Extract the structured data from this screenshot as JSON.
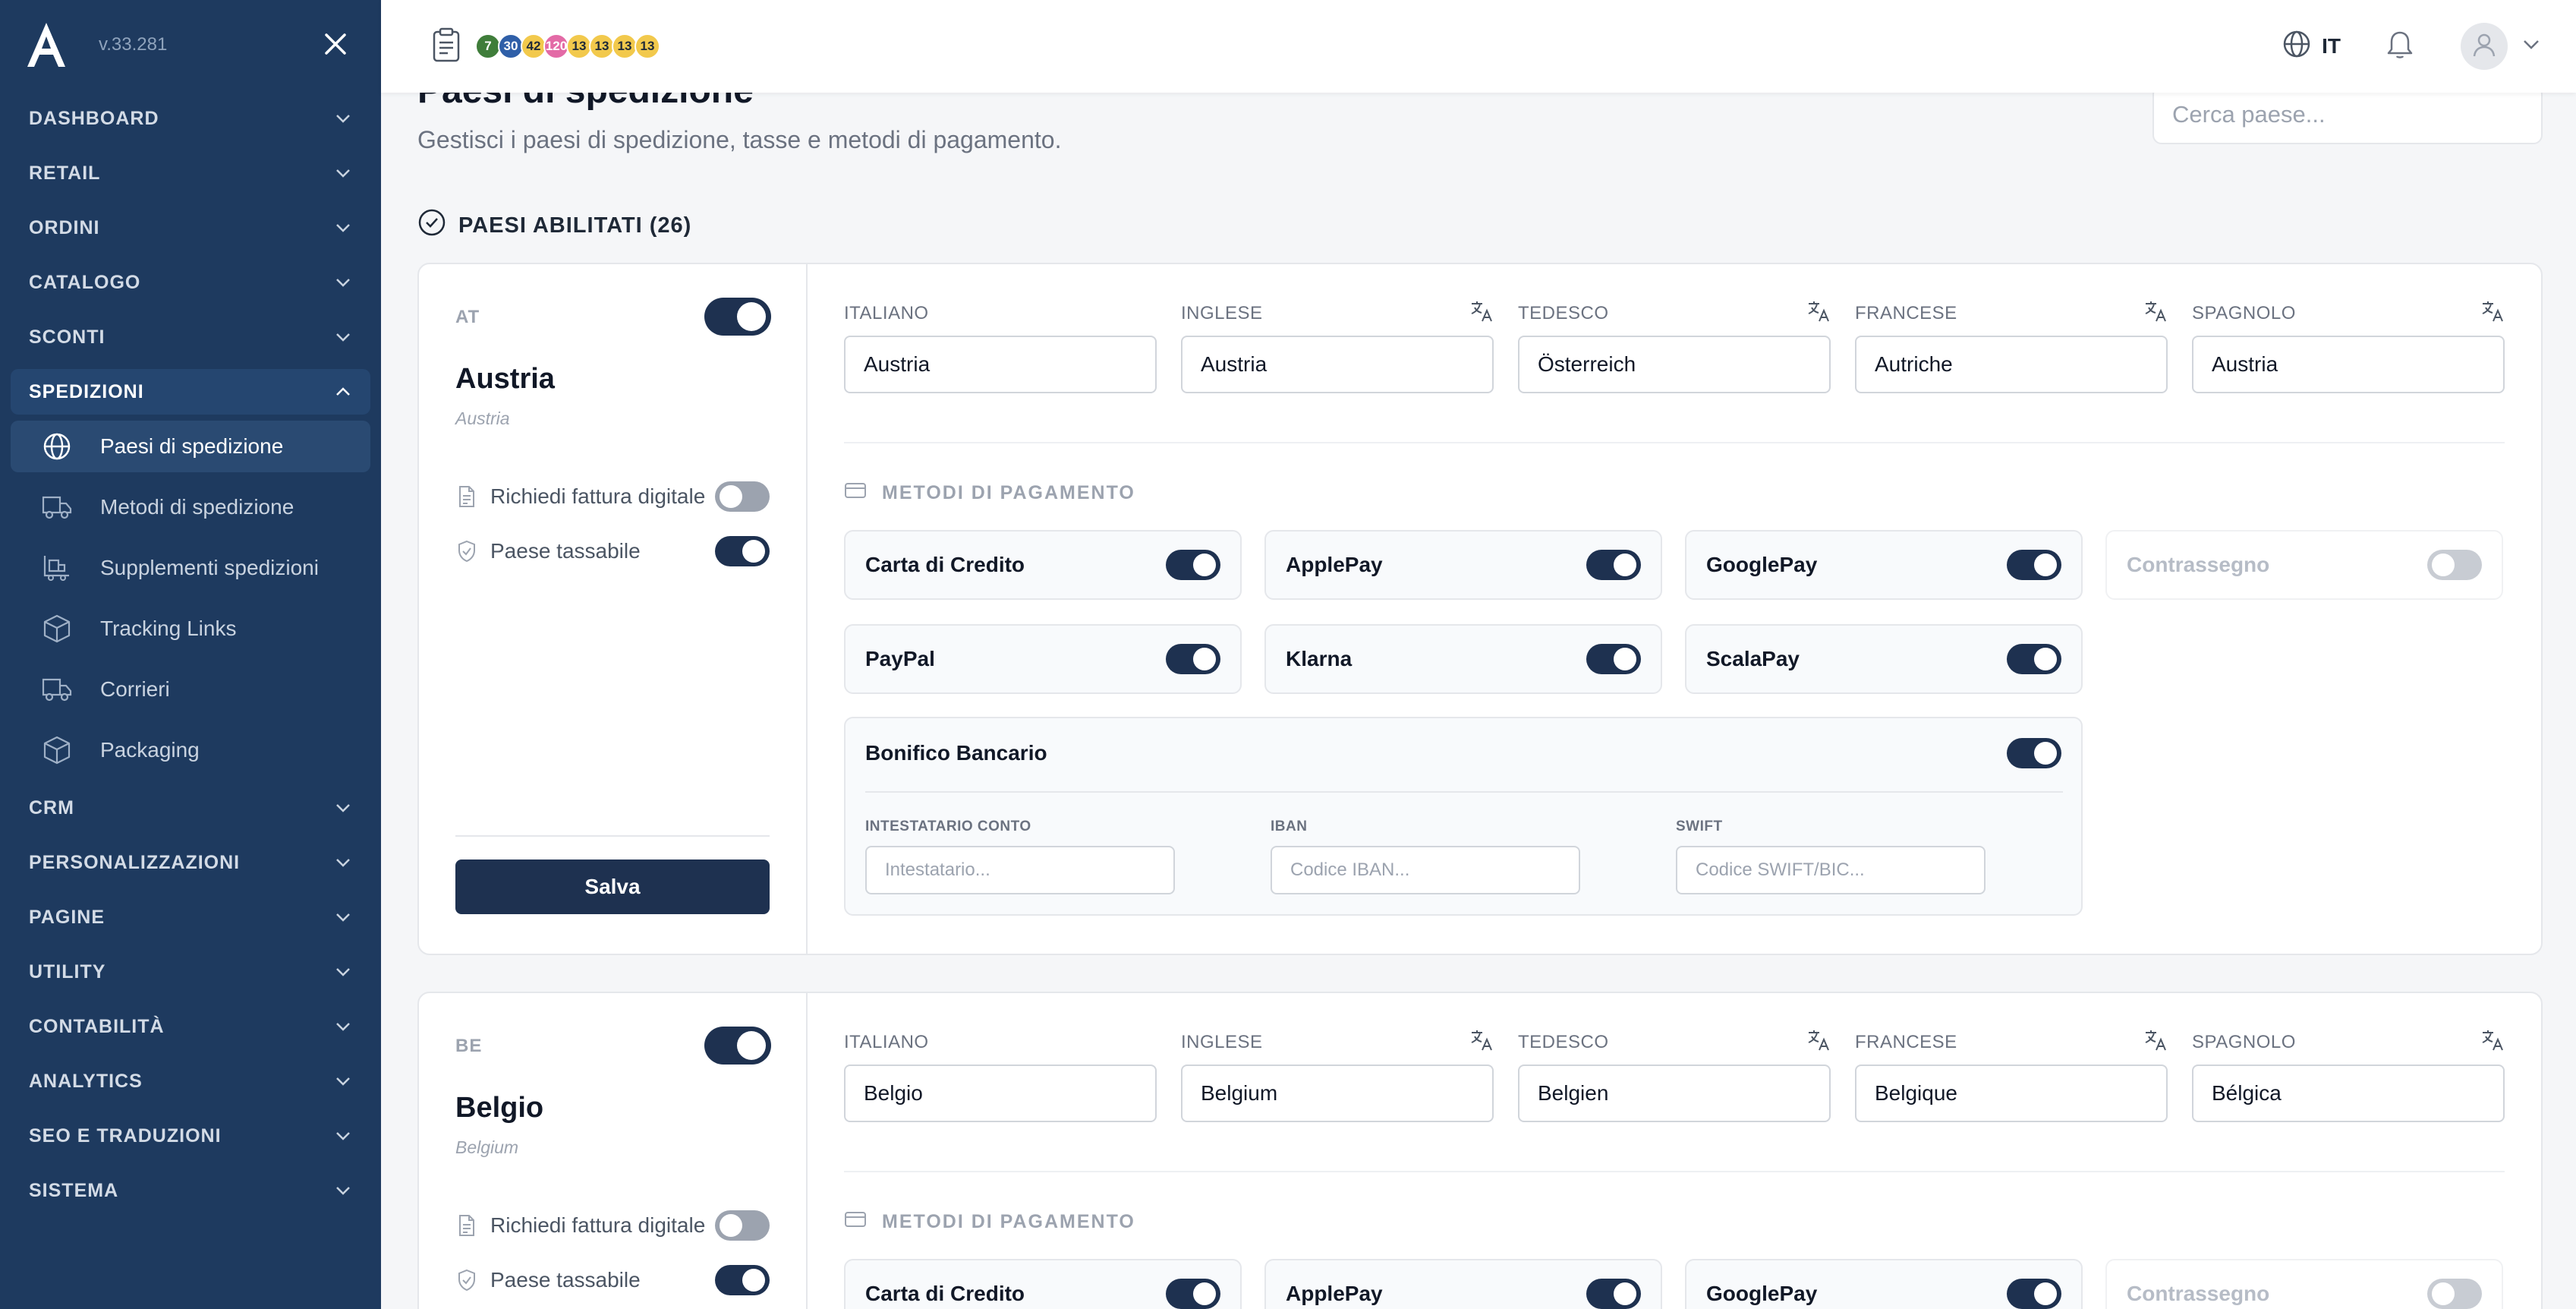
{
  "app": {
    "version": "v.33.281"
  },
  "sidebar": {
    "items": [
      {
        "label": "DASHBOARD"
      },
      {
        "label": "RETAIL"
      },
      {
        "label": "ORDINI"
      },
      {
        "label": "CATALOGO"
      },
      {
        "label": "SCONTI"
      },
      {
        "label": "SPEDIZIONI"
      },
      {
        "label": "CRM"
      },
      {
        "label": "PERSONALIZZAZIONI"
      },
      {
        "label": "PAGINE"
      },
      {
        "label": "UTILITY"
      },
      {
        "label": "CONTABILITÀ"
      },
      {
        "label": "ANALYTICS"
      },
      {
        "label": "SEO E TRADUZIONI"
      },
      {
        "label": "SISTEMA"
      }
    ],
    "spedizioni_sub": [
      {
        "label": "Paesi di spedizione",
        "icon": "globe-icon"
      },
      {
        "label": "Metodi di spedizione",
        "icon": "truck-icon"
      },
      {
        "label": "Supplementi spedizioni",
        "icon": "truck-box-icon"
      },
      {
        "label": "Tracking Links",
        "icon": "box-icon"
      },
      {
        "label": "Corrieri",
        "icon": "truck-icon"
      },
      {
        "label": "Packaging",
        "icon": "box-icon"
      }
    ]
  },
  "topbar": {
    "badges": [
      {
        "value": "7",
        "color": "#3f7d3a"
      },
      {
        "value": "30",
        "color": "#2f5fa8"
      },
      {
        "value": "42",
        "color": "#f2c94c"
      },
      {
        "value": "120",
        "color": "#e36aa6"
      },
      {
        "value": "13",
        "color": "#f2c94c"
      },
      {
        "value": "13",
        "color": "#f2c94c"
      },
      {
        "value": "13",
        "color": "#f2c94c"
      },
      {
        "value": "13",
        "color": "#f2c94c"
      }
    ],
    "language": "IT"
  },
  "page": {
    "title": "Paesi di spedizione",
    "subtitle": "Gestisci i paesi di spedizione, tasse e metodi di pagamento.",
    "search_placeholder": "Cerca paese...",
    "section_title": "PAESI ABILITATI (26)"
  },
  "labels": {
    "lang_it": "ITALIANO",
    "lang_en": "INGLESE",
    "lang_de": "TEDESCO",
    "lang_fr": "FRANCESE",
    "lang_es": "SPAGNOLO",
    "digital_invoice": "Richiedi fattura digitale",
    "taxable": "Paese tassabile",
    "save": "Salva",
    "payment_methods": "METODI DI PAGAMENTO",
    "bank_transfer": "Bonifico Bancario",
    "account_holder": "INTESTATARIO CONTO",
    "iban": "IBAN",
    "swift": "SWIFT",
    "account_holder_ph": "Intestatario...",
    "iban_ph": "Codice IBAN...",
    "swift_ph": "Codice SWIFT/BIC..."
  },
  "countries": [
    {
      "code": "AT",
      "name": "Austria",
      "name_en": "Austria",
      "translations": {
        "it": "Austria",
        "en": "Austria",
        "de": "Österreich",
        "fr": "Autriche",
        "es": "Austria"
      },
      "enabled": true,
      "digital_invoice": false,
      "taxable": true,
      "payments": [
        {
          "label": "Carta di Credito",
          "on": true
        },
        {
          "label": "ApplePay",
          "on": true
        },
        {
          "label": "GooglePay",
          "on": true
        },
        {
          "label": "Contrassegno",
          "on": false
        },
        {
          "label": "PayPal",
          "on": true
        },
        {
          "label": "Klarna",
          "on": true
        },
        {
          "label": "ScalaPay",
          "on": true
        }
      ],
      "bank_transfer_on": true
    },
    {
      "code": "BE",
      "name": "Belgio",
      "name_en": "Belgium",
      "translations": {
        "it": "Belgio",
        "en": "Belgium",
        "de": "Belgien",
        "fr": "Belgique",
        "es": "Bélgica"
      },
      "enabled": true,
      "digital_invoice": false,
      "taxable": true,
      "payments": [
        {
          "label": "Carta di Credito",
          "on": true
        },
        {
          "label": "ApplePay",
          "on": true
        },
        {
          "label": "GooglePay",
          "on": true
        },
        {
          "label": "Contrassegno",
          "on": false
        }
      ]
    }
  ]
}
